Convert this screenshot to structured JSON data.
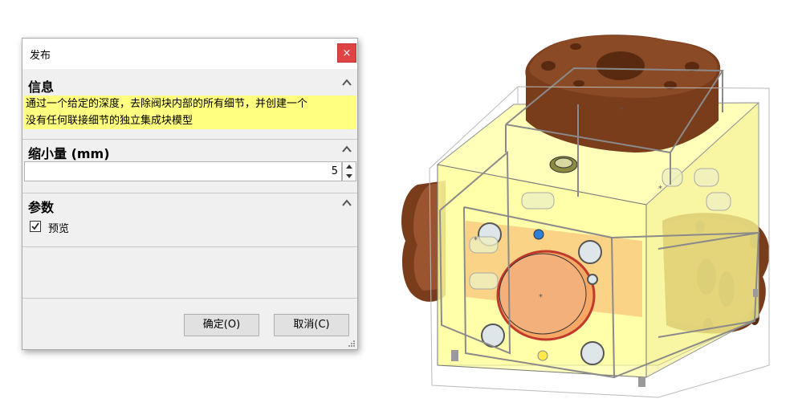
{
  "dialog": {
    "title": "发布",
    "close_glyph": "×",
    "info": {
      "header": "信息",
      "lines": [
        "通过一个给定的深度，去除阀块内部的所有细节，并创建一个",
        "没有任何联接细节的独立集成块模型"
      ]
    },
    "shrink": {
      "header": "缩小量 (mm)",
      "value": "5"
    },
    "params": {
      "header": "参数",
      "preview_label": "预览",
      "preview_checked": true
    },
    "buttons": {
      "ok_label": "确定(O)",
      "cancel_label": "取消(C)"
    }
  },
  "icons": {
    "close": "close-icon",
    "collapse": "chevron-up-icon",
    "spin_up": "spin-up-icon",
    "spin_down": "spin-down-icon",
    "check": "checkmark-icon",
    "resize": "resize-grip-icon"
  },
  "colors": {
    "close_button": "#e04343",
    "info_highlight": "#ffff80",
    "block_fill": "#ffff99",
    "flange_fill": "#8b4a26",
    "bore_fill": "#f7a865"
  }
}
